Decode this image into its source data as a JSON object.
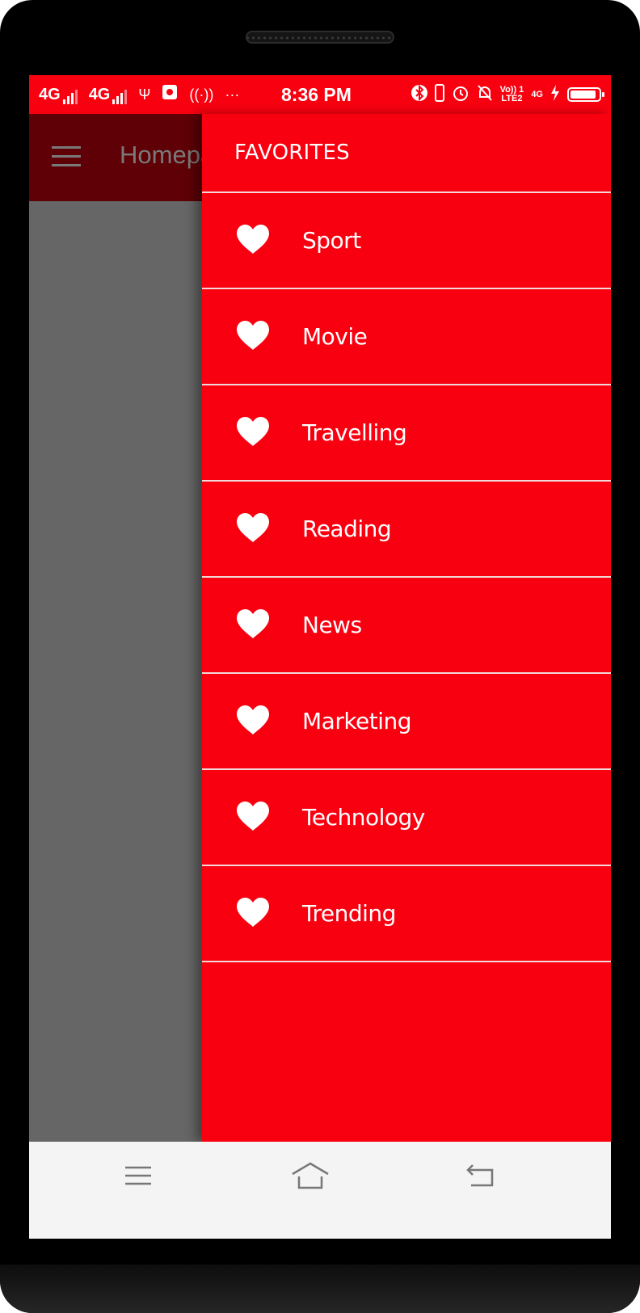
{
  "status_bar": {
    "network1": "4G",
    "network2": "4G",
    "overflow": "···",
    "time": "8:36 PM",
    "volte": "Vo)) 1",
    "lte2": "LTE2",
    "net_small": "4G"
  },
  "app_bar": {
    "title": "Homepa"
  },
  "drawer": {
    "title": "FAVORITES",
    "items": [
      {
        "label": "Sport",
        "icon": "heart-icon"
      },
      {
        "label": "Movie",
        "icon": "heart-icon"
      },
      {
        "label": "Travelling",
        "icon": "heart-icon"
      },
      {
        "label": "Reading",
        "icon": "heart-icon"
      },
      {
        "label": "News",
        "icon": "heart-icon"
      },
      {
        "label": "Marketing",
        "icon": "heart-icon"
      },
      {
        "label": "Technology",
        "icon": "heart-icon"
      },
      {
        "label": "Trending",
        "icon": "heart-icon"
      }
    ]
  },
  "colors": {
    "accent": "#f80010",
    "scrim": "#666666",
    "nav_bar": "#f4f4f4"
  },
  "battery_level": 0.9
}
